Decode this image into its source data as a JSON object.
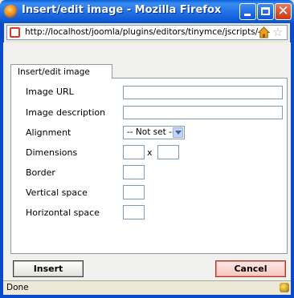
{
  "window": {
    "title": "Insert/edit image - Mozilla Firefox"
  },
  "urlbar": {
    "url": "http://localhost/joomla/plugins/editors/tinymce/jscripts/"
  },
  "dialog": {
    "tab_label": "Insert/edit image",
    "fields": {
      "image_url": {
        "label": "Image URL",
        "value": ""
      },
      "image_description": {
        "label": "Image description",
        "value": ""
      },
      "alignment": {
        "label": "Alignment",
        "selected": "-- Not set --"
      },
      "dimensions": {
        "label": "Dimensions",
        "width": "",
        "height": "",
        "separator": "x"
      },
      "border": {
        "label": "Border",
        "value": ""
      },
      "vertical_space": {
        "label": "Vertical space",
        "value": ""
      },
      "horizontal_space": {
        "label": "Horizontal space",
        "value": ""
      }
    },
    "buttons": {
      "insert": "Insert",
      "cancel": "Cancel"
    }
  },
  "statusbar": {
    "text": "Done"
  },
  "icons": {
    "app": "firefox-icon",
    "site": "site-favicon-icon",
    "home": "home-icon",
    "bookmark": "star-icon",
    "status": "security-icon"
  }
}
